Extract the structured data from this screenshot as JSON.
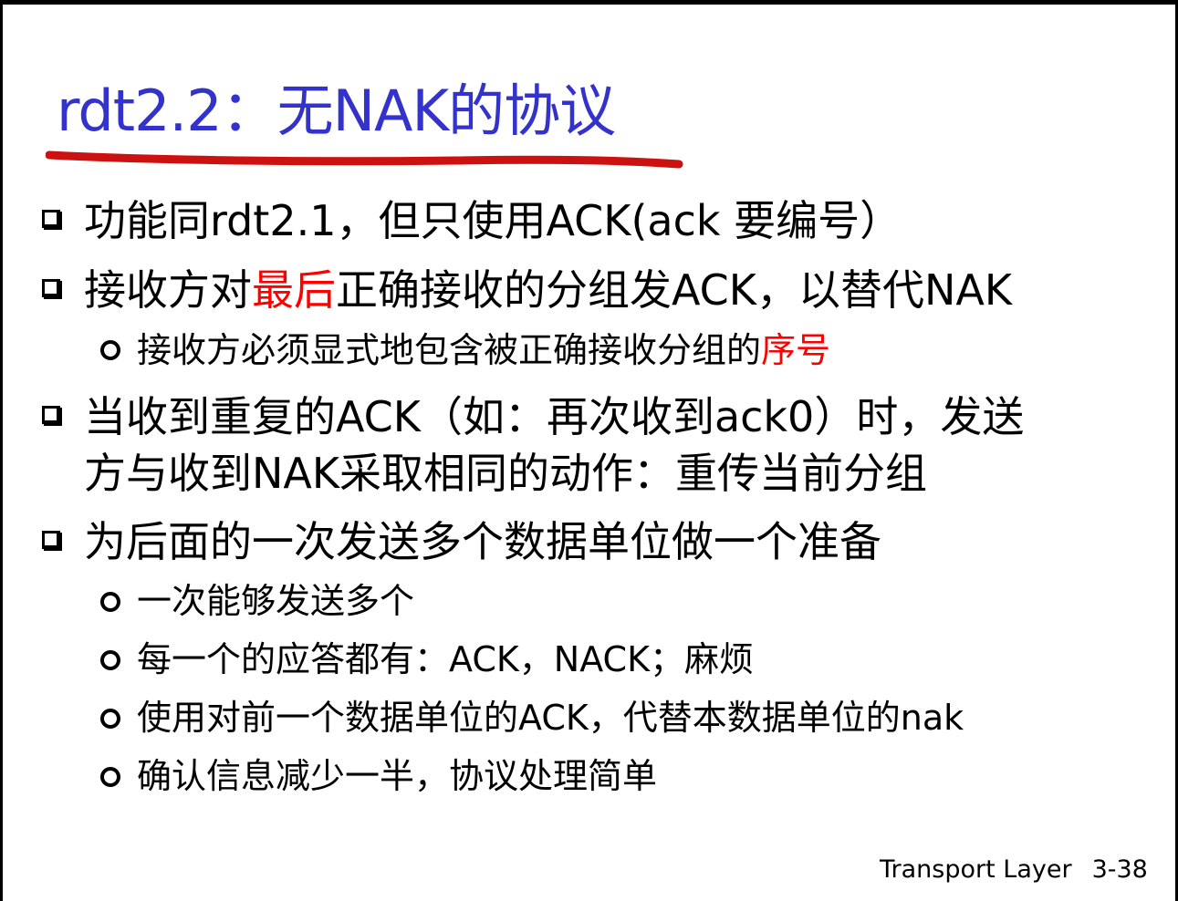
{
  "title": "rdt2.2：无NAK的协议",
  "bullets": {
    "b1": "功能同rdt2.1，但只使用ACK(ack 要编号）",
    "b2_pre": "接收方对",
    "b2_red": "最后",
    "b2_post": "正确接收的分组发ACK，以替代NAK",
    "b2_sub_pre": "接收方必须显式地包含被正确接收分组的",
    "b2_sub_red": "序号",
    "b3_line1": "当收到重复的ACK（如：再次收到ack0）时，发送",
    "b3_line2": "方与收到NAK采取相同的动作：重传当前分组",
    "b4": "为后面的一次发送多个数据单位做一个准备",
    "b4_subs": [
      "一次能够发送多个",
      "每一个的应答都有：ACK，NACK；麻烦",
      "使用对前一个数据单位的ACK，代替本数据单位的nak",
      "确认信息减少一半，协议处理简单"
    ]
  },
  "footer": {
    "label": "Transport Layer",
    "page": "3-38"
  },
  "colors": {
    "title": "#3333cc",
    "accent_red": "#ff0000",
    "underline": "#cc1111"
  }
}
